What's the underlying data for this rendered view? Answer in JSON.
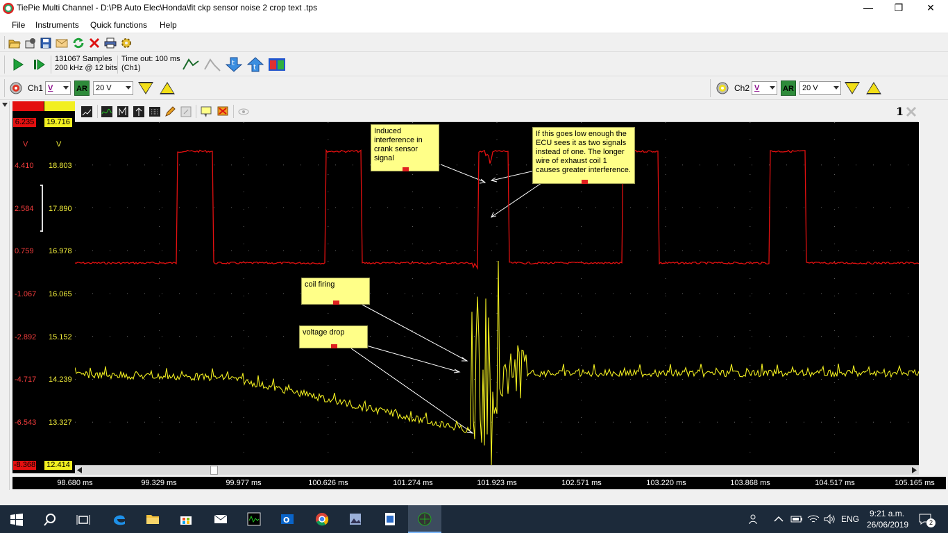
{
  "window": {
    "title": "TiePie Multi Channel - D:\\PB Auto Elec\\Honda\\fit ckp sensor noise 2 crop text .tps",
    "minimize": "—",
    "maximize": "❐",
    "close": "✕"
  },
  "menu": [
    "File",
    "Instruments",
    "Quick functions",
    "Help"
  ],
  "acquisition": {
    "samples": "131067 Samples",
    "rate": "200 kHz @ 12 bits",
    "timeout": "Time out: 100 ms",
    "channel": "(Ch1)"
  },
  "ch1": {
    "label": "Ch1",
    "coupling": "V",
    "ar": "AR",
    "range": "20 V",
    "color": "#f23c3c"
  },
  "ch2": {
    "label": "Ch2",
    "coupling": "V",
    "ar": "AR",
    "range": "20 V",
    "color": "#f3ef3b"
  },
  "plot": {
    "number": "1",
    "ch1_axis": [
      "6.235",
      "4.410",
      "2.584",
      "0.759",
      "-1.067",
      "-2.892",
      "-4.717",
      "-6.543",
      "-8.368"
    ],
    "ch2_axis": [
      "19.716",
      "18.803",
      "17.890",
      "16.978",
      "16.065",
      "15.152",
      "14.239",
      "13.327",
      "12.414"
    ],
    "ch1_unit": "V",
    "ch2_unit": "V",
    "time_axis": [
      "98.680 ms",
      "99.329 ms",
      "99.977 ms",
      "100.626 ms",
      "101.274 ms",
      "101.923 ms",
      "102.571 ms",
      "103.220 ms",
      "103.868 ms",
      "104.517 ms",
      "105.165 ms"
    ]
  },
  "annotations": {
    "interference": "Induced interference in crank sensor signal",
    "ecu": "If this goes low enough the ECU sees it as two signals instead of one. The longer wire of exhaust coil 1 causes greater interference.",
    "coil": "coil firing",
    "drop": "voltage drop"
  },
  "taskbar": {
    "language": "ENG",
    "time": "9:21 a.m.",
    "date": "26/06/2019",
    "notifications": "2"
  }
}
